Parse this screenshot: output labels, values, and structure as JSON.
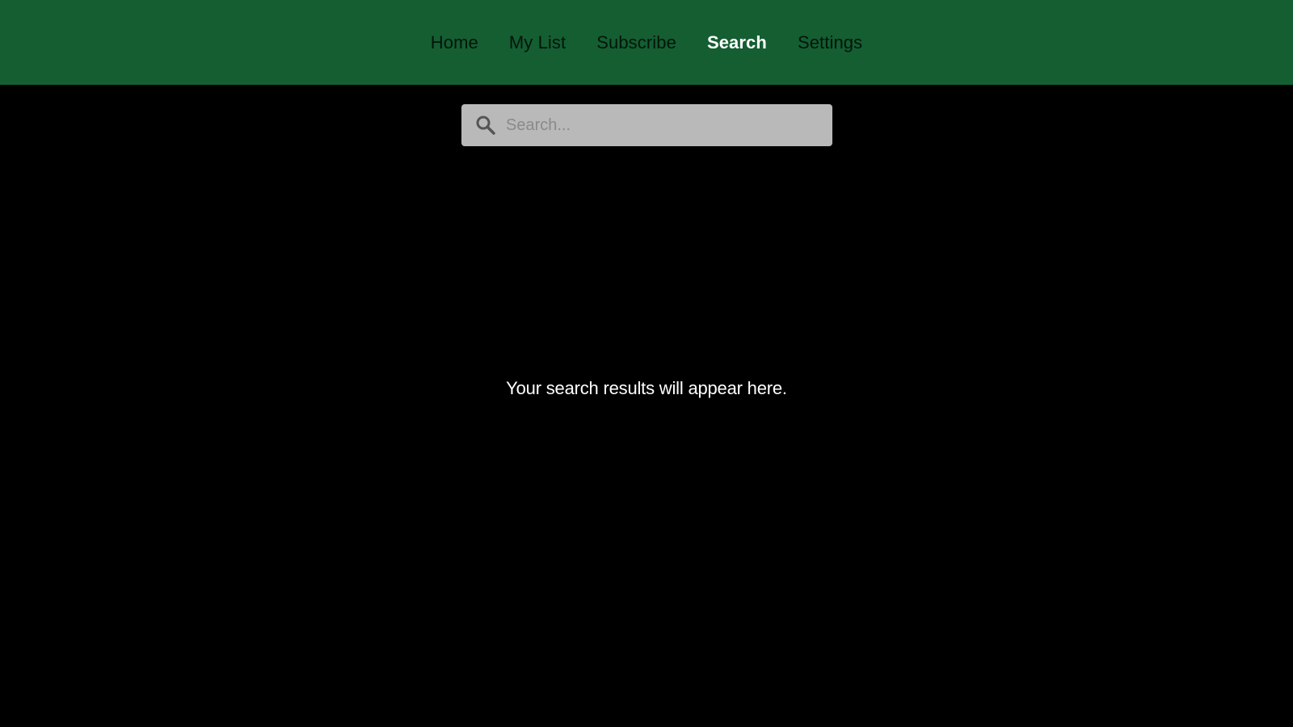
{
  "nav": {
    "items": [
      {
        "label": "Home",
        "active": false
      },
      {
        "label": "My List",
        "active": false
      },
      {
        "label": "Subscribe",
        "active": false
      },
      {
        "label": "Search",
        "active": true
      },
      {
        "label": "Settings",
        "active": false
      }
    ]
  },
  "search": {
    "placeholder": "Search...",
    "value": "",
    "icon": "search-icon"
  },
  "results": {
    "empty_message": "Your search results will appear here."
  },
  "colors": {
    "navbar_bg": "#145e32",
    "page_bg": "#000000",
    "search_bg": "#b9b9b9",
    "active_nav": "#ffffff",
    "inactive_nav": "#05150b"
  }
}
